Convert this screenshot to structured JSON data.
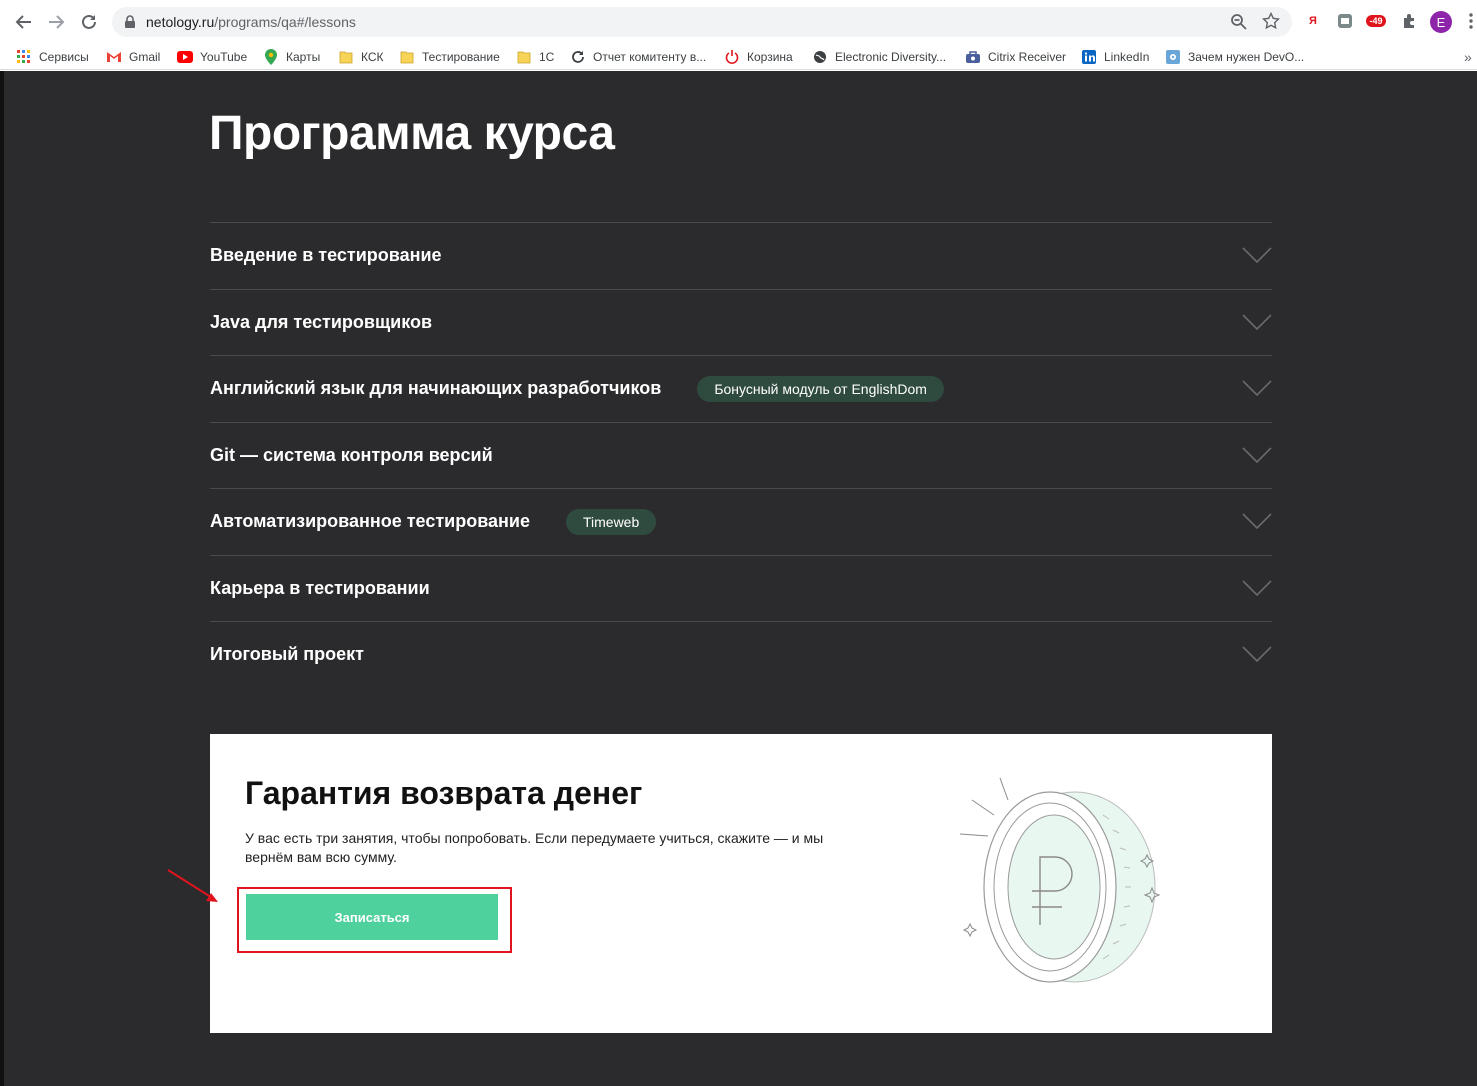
{
  "browser": {
    "url_host": "netology.ru",
    "url_path": "/programs/qa#/lessons",
    "profile_initial": "E",
    "ext_yandex": "Я",
    "ext_badge": "-49"
  },
  "bookmarks": [
    {
      "label": "Сервисы",
      "icon": "apps-grid-icon"
    },
    {
      "label": "Gmail",
      "icon": "gmail-icon"
    },
    {
      "label": "YouTube",
      "icon": "youtube-icon"
    },
    {
      "label": "Карты",
      "icon": "maps-pin-icon"
    },
    {
      "label": "КСК",
      "icon": "folder-icon"
    },
    {
      "label": "Тестирование",
      "icon": "folder-icon"
    },
    {
      "label": "1С",
      "icon": "folder-icon"
    },
    {
      "label": "Отчет комитенту в...",
      "icon": "refresh-icon"
    },
    {
      "label": "Корзина",
      "icon": "power-icon"
    },
    {
      "label": "Electronic Diversity...",
      "icon": "globe-icon"
    },
    {
      "label": "Citrix Receiver",
      "icon": "citrix-icon"
    },
    {
      "label": "LinkedIn",
      "icon": "linkedin-icon"
    },
    {
      "label": "Зачем нужен DevO...",
      "icon": "gear-icon"
    }
  ],
  "page": {
    "title": "Программа курса",
    "lessons": [
      {
        "title": "Введение в тестирование",
        "badge": ""
      },
      {
        "title": "Java для тестировщиков",
        "badge": ""
      },
      {
        "title": "Английский язык для начинающих разработчиков",
        "badge": "Бонусный модуль от EnglishDom"
      },
      {
        "title": "Git — система контроля версий",
        "badge": ""
      },
      {
        "title": "Автоматизированное тестирование",
        "badge": "Timeweb"
      },
      {
        "title": "Карьера в тестировании",
        "badge": ""
      },
      {
        "title": "Итоговый проект",
        "badge": ""
      }
    ]
  },
  "guarantee": {
    "title": "Гарантия возврата денег",
    "text": "У вас есть три занятия, чтобы попробовать. Если передумаете учиться, скажите — и мы вернём вам всю сумму.",
    "button": "Записаться"
  },
  "colors": {
    "page_bg": "#2b2b2e",
    "accent_green": "#4fd19e",
    "badge_bg": "#2f4a3f",
    "highlight_red": "#e0141c"
  }
}
